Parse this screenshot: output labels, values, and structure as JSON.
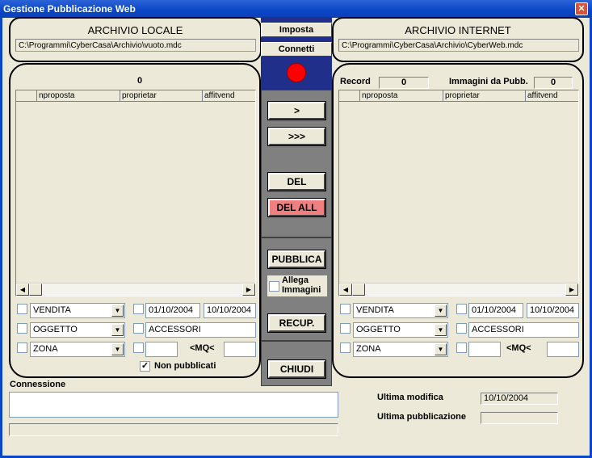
{
  "window": {
    "title": "Gestione Pubblicazione Web",
    "close_glyph": "✕"
  },
  "local": {
    "title": "ARCHIVIO LOCALE",
    "path": "C:\\Programmi\\CyberCasa\\Archivio\\vuoto.mdc",
    "count": "0",
    "columns": [
      "nproposta",
      "proprietar",
      "affitvend"
    ],
    "filters": {
      "type": "VENDITA",
      "object": "OGGETTO",
      "zone": "ZONA",
      "date_from": "01/10/2004",
      "date_to": "10/10/2004",
      "accessories": "ACCESSORI",
      "mq_label": "<MQ<",
      "non_published_label": "Non pubblicati"
    }
  },
  "internet": {
    "title": "ARCHIVIO INTERNET",
    "path": "C:\\Programmi\\CyberCasa\\Archivio\\CyberWeb.mdc",
    "record_label": "Record",
    "record_count": "0",
    "images_label": "Immagini da Pubb.",
    "images_count": "0",
    "columns": [
      "nproposta",
      "proprietar",
      "affitvend"
    ],
    "filters": {
      "type": "VENDITA",
      "object": "OGGETTO",
      "zone": "ZONA",
      "date_from": "01/10/2004",
      "date_to": "10/10/2004",
      "accessories": "ACCESSORI",
      "mq_label": "<MQ<"
    }
  },
  "center": {
    "imposta": "Imposta",
    "connetti": "Connetti",
    "status_color": "#ff0000",
    "move_one": ">",
    "move_all": ">>>",
    "del": "DEL",
    "del_all": "DEL ALL",
    "pubblica": "PUBBLICA",
    "attach_images": "Allega Immagini",
    "recup": "RECUP.",
    "chiudi": "CHIUDI"
  },
  "connection": {
    "label": "Connessione",
    "last_modified_label": "Ultima modifica",
    "last_modified_value": "10/10/2004",
    "last_publish_label": "Ultima pubblicazione",
    "last_publish_value": ""
  }
}
